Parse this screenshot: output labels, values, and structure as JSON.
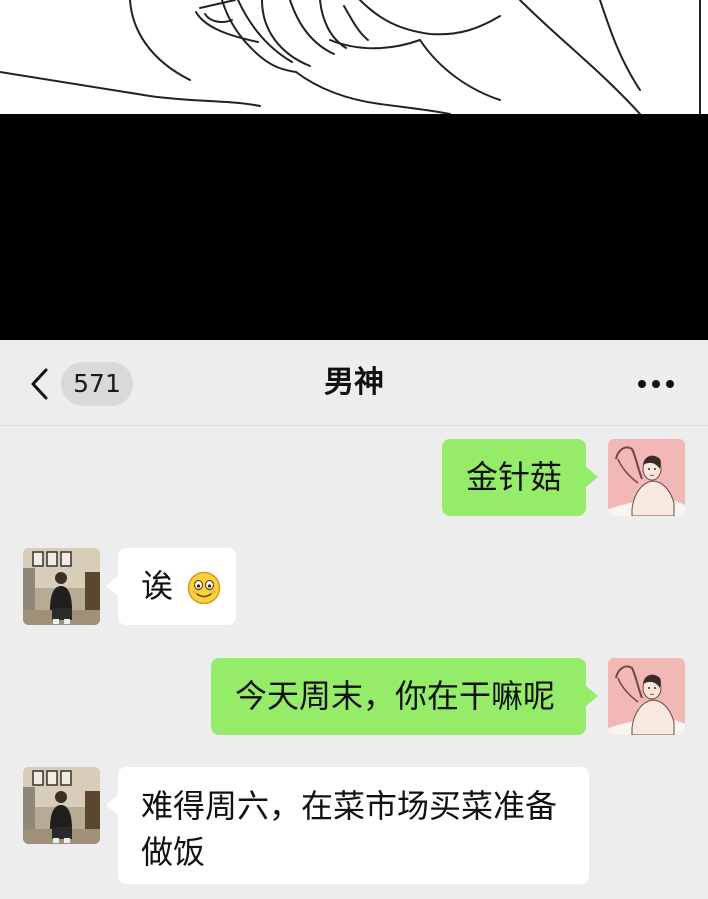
{
  "comic": {
    "illustration": "line-art-hands-holding-phone"
  },
  "header": {
    "back_icon": "chevron-left-icon",
    "unread_count": "571",
    "title": "男神",
    "more_icon": "more-dots-icon"
  },
  "messages": [
    {
      "side": "sent",
      "sender": "me",
      "text": "金针菇",
      "avatar_icon": "woman-pink-avatar"
    },
    {
      "side": "received",
      "sender": "contact",
      "text": "诶",
      "emoji": "smiley-emoji",
      "avatar_icon": "man-sitting-avatar"
    },
    {
      "side": "sent",
      "sender": "me",
      "text": "今天周末，你在干嘛呢",
      "avatar_icon": "woman-pink-avatar"
    },
    {
      "side": "received",
      "sender": "contact",
      "text_line1": "难得周六，在菜市场买菜准备",
      "text_line2": "做饭",
      "avatar_icon": "man-sitting-avatar"
    }
  ],
  "colors": {
    "background": "#ededed",
    "sent_bubble": "#95ec69",
    "received_bubble": "#ffffff",
    "black_band": "#000000"
  }
}
